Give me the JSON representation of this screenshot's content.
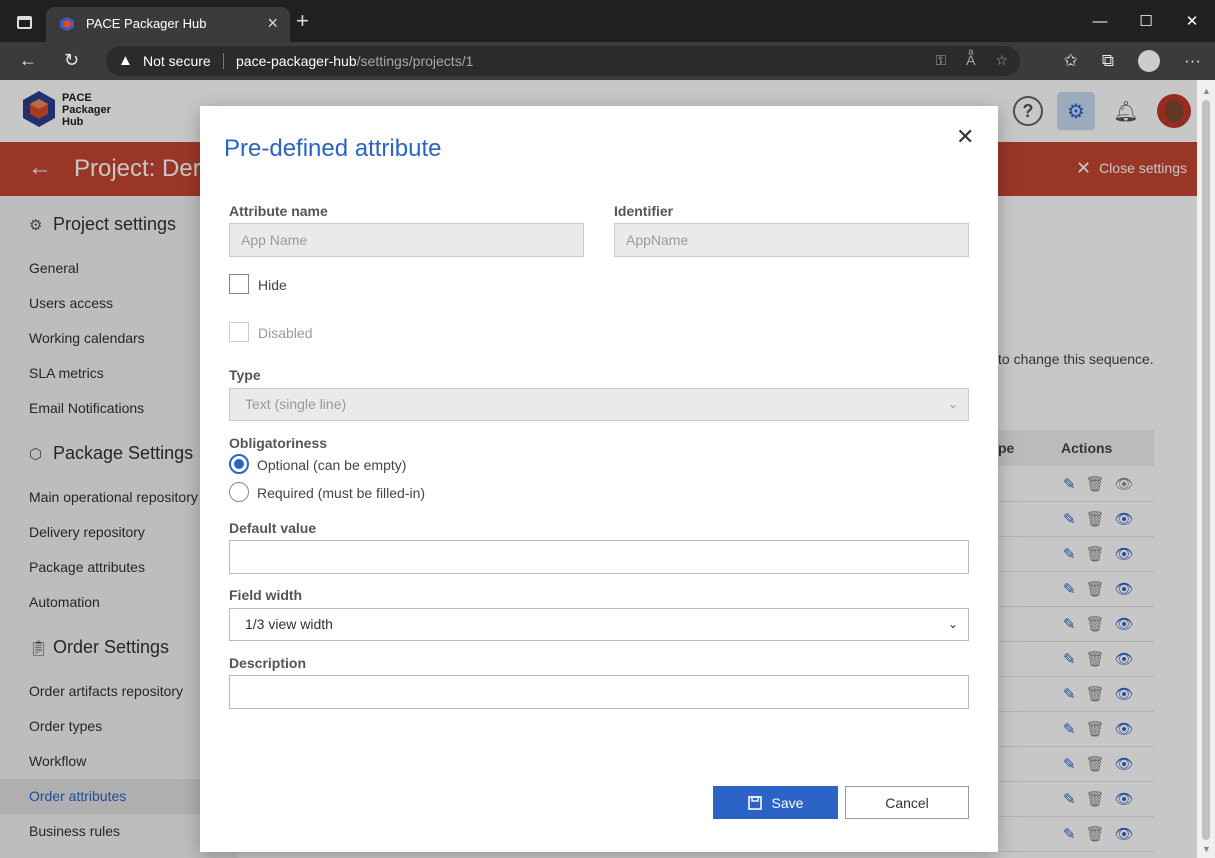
{
  "browser": {
    "tab_title": "PACE Packager Hub",
    "not_secure": "Not secure",
    "url_host": "pace-packager-hub",
    "url_path": "/settings/projects/1"
  },
  "app": {
    "logo_line1": "PACE",
    "logo_line2": "Packager",
    "logo_line3": "Hub",
    "project_title": "Project: Der",
    "close_settings": "Close settings"
  },
  "sidebar": {
    "project_settings": "Project settings",
    "project_items": [
      "General",
      "Users access",
      "Working calendars",
      "SLA metrics",
      "Email Notifications"
    ],
    "package_settings": "Package Settings",
    "package_items": [
      "Main operational repository",
      "Delivery repository",
      "Package attributes",
      "Automation"
    ],
    "order_settings": "Order Settings",
    "order_items": [
      "Order artifacts repository",
      "Order types",
      "Workflow",
      "Order attributes",
      "Business rules"
    ]
  },
  "background": {
    "sequence_text": "to change this sequence.",
    "col_type_partial": "pe",
    "col_actions": "Actions"
  },
  "modal": {
    "title": "Pre-defined attribute",
    "attribute_name_label": "Attribute name",
    "attribute_name_placeholder": "App Name",
    "identifier_label": "Identifier",
    "identifier_placeholder": "AppName",
    "hide_label": "Hide",
    "disabled_label": "Disabled",
    "type_label": "Type",
    "type_value": "Text (single line)",
    "obligatoriness_label": "Obligatoriness",
    "optional_label": "Optional (can be empty)",
    "required_label": "Required (must be filled-in)",
    "default_value_label": "Default value",
    "default_value": "",
    "field_width_label": "Field width",
    "field_width_value": "1/3 view width",
    "description_label": "Description",
    "description_value": "",
    "save_label": "Save",
    "cancel_label": "Cancel"
  }
}
